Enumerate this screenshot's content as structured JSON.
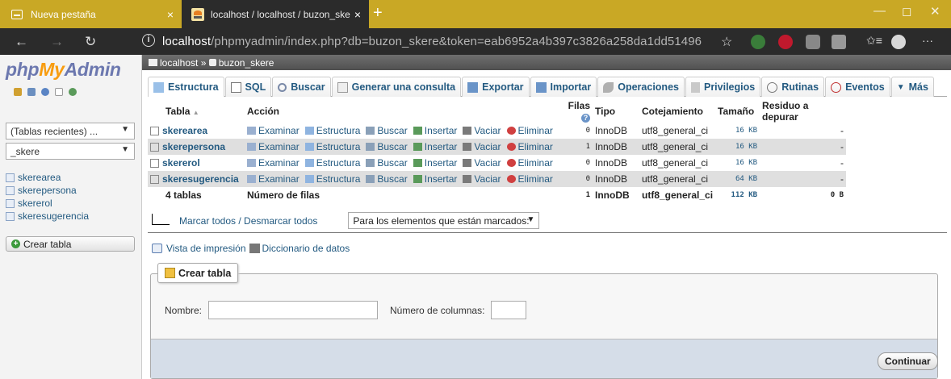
{
  "browser": {
    "tabs": [
      {
        "title": "Nueva pestaña",
        "close": "×"
      },
      {
        "title": "localhost / localhost / buzon_ske",
        "close": "×"
      }
    ],
    "new_tab": "+",
    "window_controls": {
      "minimize": "—",
      "maximize": "◻",
      "close": "✕"
    },
    "url_host": "localhost",
    "url_rest": "/phpmyadmin/index.php?db=buzon_skere&token=eab6952a4b397c3826a258da1dd51496",
    "info_glyph": "i",
    "star": "☆",
    "collections": "✩≡",
    "more": "···"
  },
  "sidebar": {
    "logo_php": "php",
    "logo_my": "My",
    "logo_admin": "Admin",
    "recent": "(Tablas recientes) ...",
    "db_select": "_skere",
    "tables": [
      "skerearea",
      "skerepersona",
      "skererol",
      "skeresugerencia"
    ],
    "create_table": "Crear tabla"
  },
  "breadcrumb": {
    "server": "localhost",
    "sep": "»",
    "db": "buzon_skere"
  },
  "menu": [
    "Estructura",
    "SQL",
    "Buscar",
    "Generar una consulta",
    "Exportar",
    "Importar",
    "Operaciones",
    "Privilegios",
    "Rutinas",
    "Eventos",
    "Más"
  ],
  "table": {
    "headers": {
      "tabla": "Tabla",
      "accion": "Acción",
      "filas": "Filas",
      "tipo": "Tipo",
      "cotejamiento": "Cotejamiento",
      "tamano": "Tamaño",
      "residuo": "Residuo a depurar"
    },
    "sort_glyph": "▲",
    "help_glyph": "?",
    "actions": [
      "Examinar",
      "Estructura",
      "Buscar",
      "Insertar",
      "Vaciar",
      "Eliminar"
    ],
    "rows": [
      {
        "name": "skerearea",
        "rows": "0",
        "type": "InnoDB",
        "collation": "utf8_general_ci",
        "size": "16 KB",
        "overhead": "-"
      },
      {
        "name": "skerepersona",
        "rows": "1",
        "type": "InnoDB",
        "collation": "utf8_general_ci",
        "size": "16 KB",
        "overhead": "-"
      },
      {
        "name": "skererol",
        "rows": "0",
        "type": "InnoDB",
        "collation": "utf8_general_ci",
        "size": "16 KB",
        "overhead": "-"
      },
      {
        "name": "skeresugerencia",
        "rows": "0",
        "type": "InnoDB",
        "collation": "utf8_general_ci",
        "size": "64 KB",
        "overhead": "-"
      }
    ],
    "footer": {
      "count": "4 tablas",
      "label": "Número de filas",
      "rows": "1",
      "type": "InnoDB",
      "collation": "utf8_general_ci",
      "size": "112 KB",
      "overhead": "0 B"
    }
  },
  "bulk": {
    "check_all": "Marcar todos / Desmarcar todos",
    "with_selected": "Para los elementos que están marcados:"
  },
  "print": {
    "print_view": "Vista de impresión",
    "dictionary": "Diccionario de datos"
  },
  "create": {
    "legend": "Crear tabla",
    "name_label": "Nombre:",
    "name_value": "",
    "cols_label": "Número de columnas:",
    "cols_value": "",
    "submit": "Continuar"
  }
}
